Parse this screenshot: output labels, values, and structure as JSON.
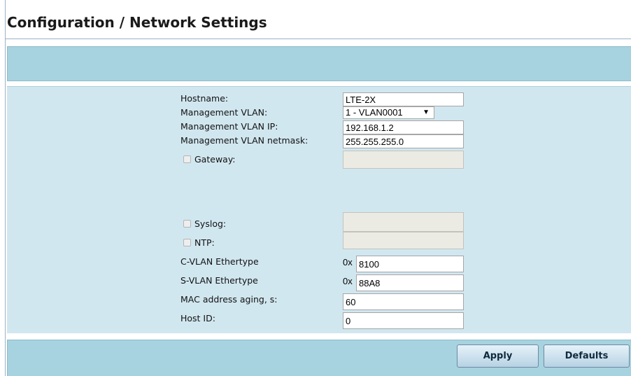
{
  "header": {
    "title": "Configuration / Network Settings"
  },
  "form": {
    "hostname": {
      "label": "Hostname:",
      "value": "LTE-2X"
    },
    "management_vlan": {
      "label": "Management VLAN:",
      "selected": "1 - VLAN0001"
    },
    "management_vlan_ip": {
      "label": "Management VLAN IP:",
      "value": "192.168.1.2"
    },
    "management_vlan_netmask": {
      "label": "Management VLAN netmask:",
      "value": "255.255.255.0"
    },
    "gateway": {
      "label": "Gateway:",
      "checked": false,
      "value": ""
    },
    "syslog": {
      "label": "Syslog:",
      "checked": false,
      "value": ""
    },
    "ntp": {
      "label": "NTP:",
      "checked": false,
      "value": ""
    },
    "c_vlan_ethertype": {
      "label": "C-VLAN Ethertype",
      "prefix": "0x",
      "value": "8100"
    },
    "s_vlan_ethertype": {
      "label": "S-VLAN Ethertype",
      "prefix": "0x",
      "value": "88A8"
    },
    "mac_aging": {
      "label": "MAC address aging, s:",
      "value": "60"
    },
    "host_id": {
      "label": "Host ID:",
      "value": "0"
    }
  },
  "buttons": {
    "apply": "Apply",
    "defaults": "Defaults"
  },
  "colors": {
    "bar": "#a7d2df",
    "panel": "#d1e7f0",
    "disabled_input": "#ebebe4"
  },
  "icons": {
    "dropdown": "triangle-down-icon",
    "checkbox": "checkbox-icon"
  }
}
